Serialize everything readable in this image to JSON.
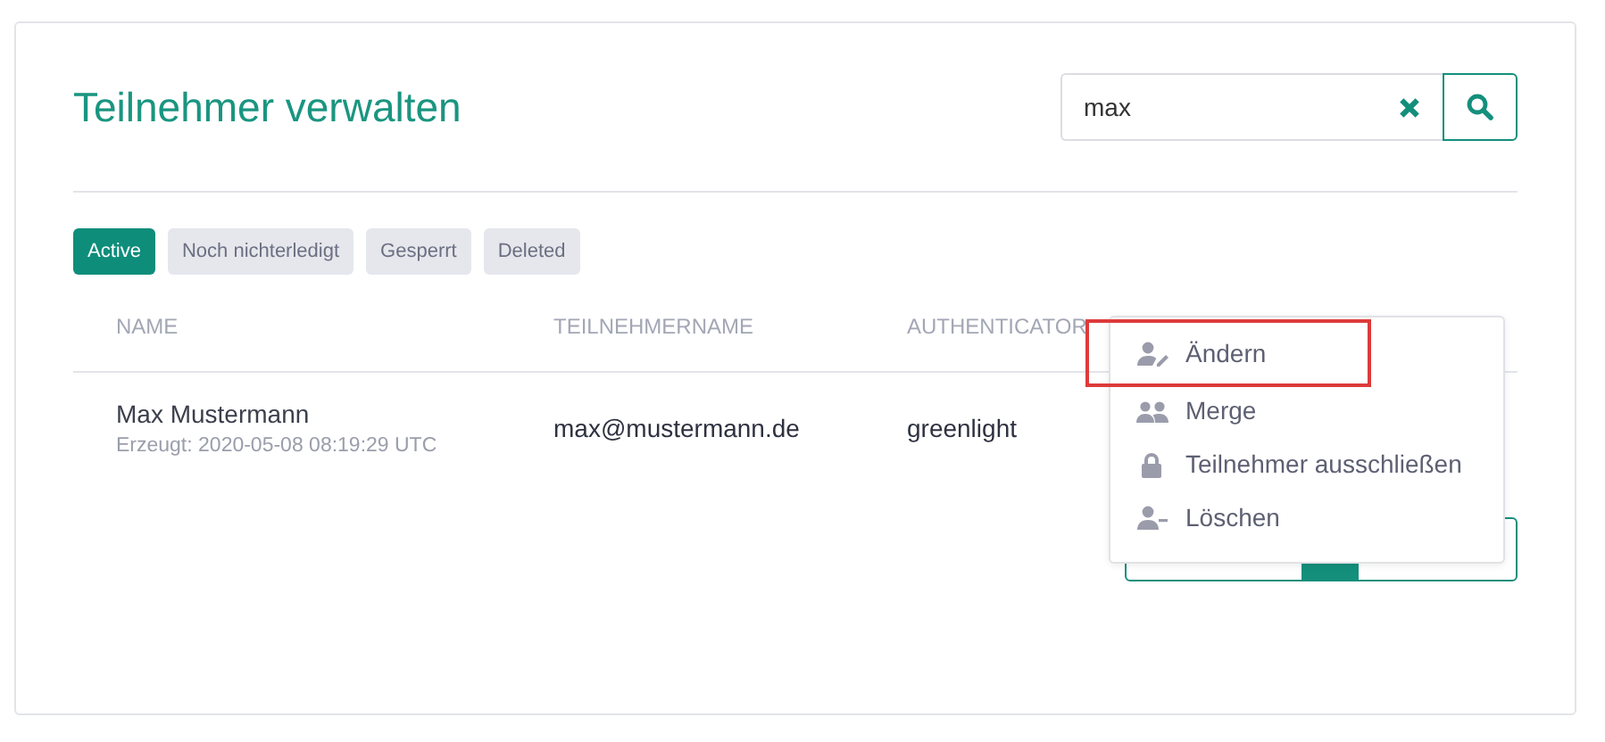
{
  "title": "Teilnehmer verwalten",
  "search": {
    "value": "max"
  },
  "filters": [
    {
      "label": "Active",
      "selected": true
    },
    {
      "label": "Noch nichterledigt",
      "selected": false
    },
    {
      "label": "Gesperrt",
      "selected": false
    },
    {
      "label": "Deleted",
      "selected": false
    }
  ],
  "table": {
    "columns": [
      "NAME",
      "TEILNEHMERNAME",
      "AUTHENTICATOR"
    ],
    "rows": [
      {
        "name": "Max Mustermann",
        "created": "Erzeugt: 2020-05-08 08:19:29 UTC",
        "username": "max@mustermann.de",
        "authenticator": "greenlight"
      }
    ]
  },
  "menu": {
    "items": [
      {
        "kind": "edit",
        "label": "Ändern",
        "highlighted": true
      },
      {
        "kind": "merge",
        "label": "Merge",
        "highlighted": false
      },
      {
        "kind": "lock",
        "label": "Teilnehmer ausschließen",
        "highlighted": false
      },
      {
        "kind": "remove",
        "label": "Löschen",
        "highlighted": false
      }
    ]
  }
}
